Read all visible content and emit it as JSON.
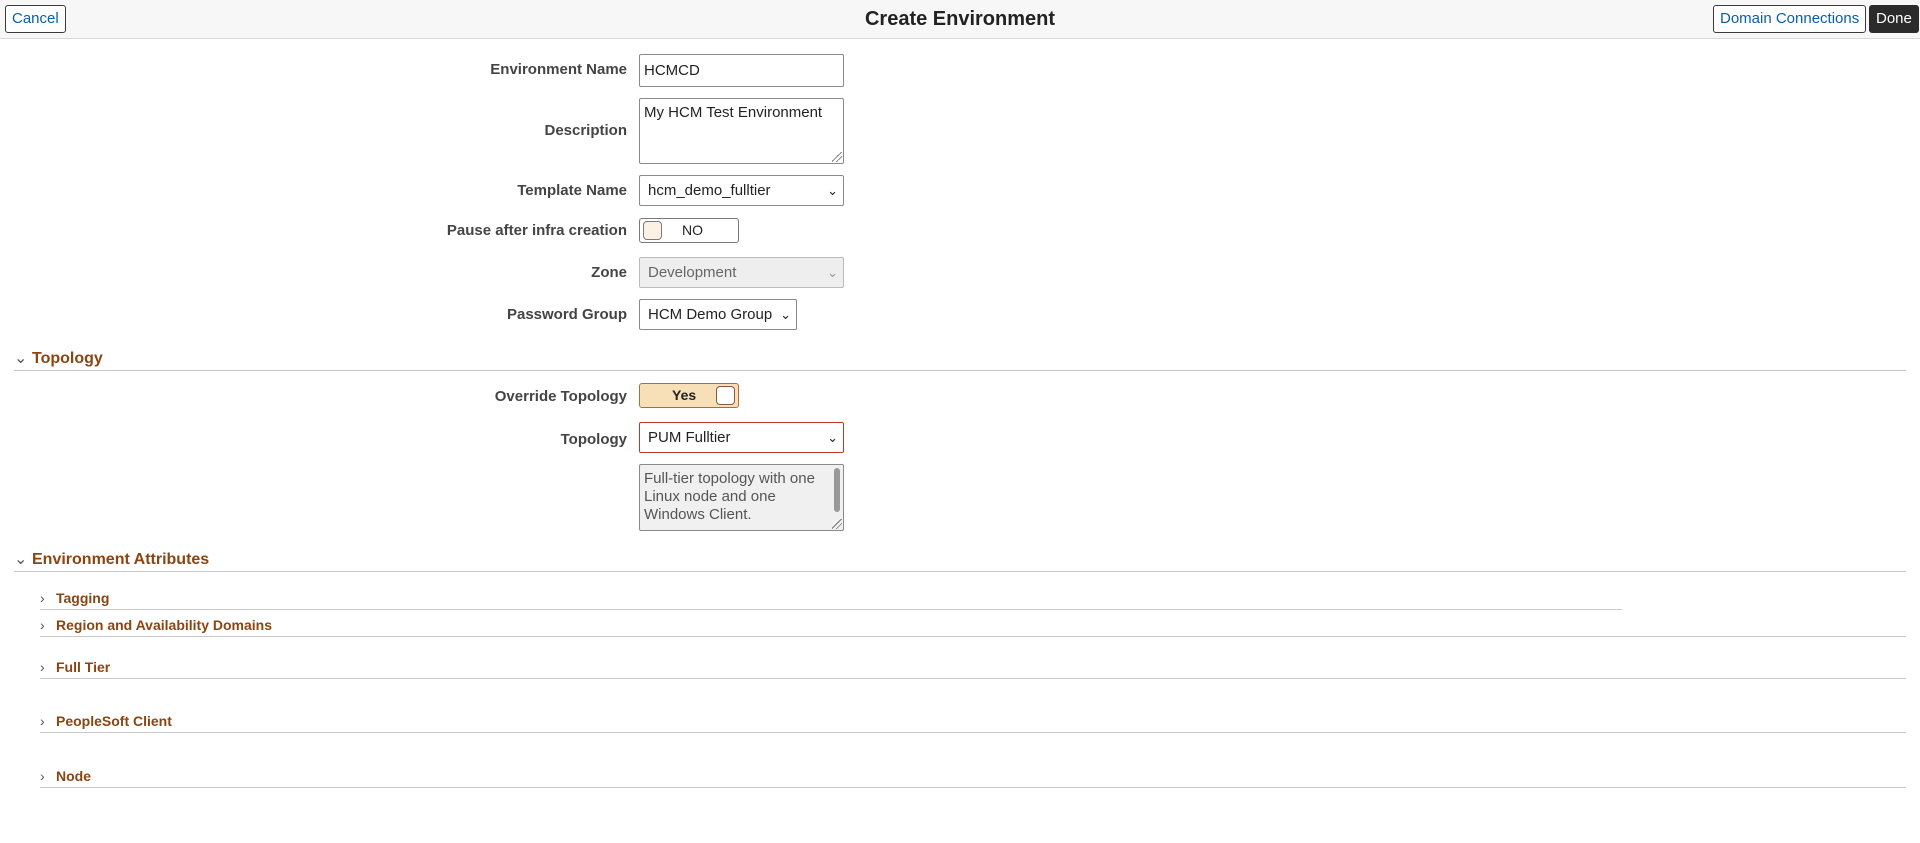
{
  "header": {
    "title": "Create Environment",
    "cancel_label": "Cancel",
    "domain_connections_label": "Domain Connections",
    "done_label": "Done"
  },
  "form": {
    "environment_name": {
      "label": "Environment Name",
      "value": "HCMCD"
    },
    "description": {
      "label": "Description",
      "value": "My HCM Test Environment"
    },
    "template_name": {
      "label": "Template Name",
      "value": "hcm_demo_fulltier"
    },
    "pause_after_infra": {
      "label": "Pause after infra creation",
      "value": "NO",
      "on": false
    },
    "zone": {
      "label": "Zone",
      "value": "Development",
      "disabled": true
    },
    "password_group": {
      "label": "Password Group",
      "value": "HCM Demo Group"
    }
  },
  "topology_section": {
    "title": "Topology",
    "expanded": true,
    "override_topology": {
      "label": "Override Topology",
      "value": "Yes",
      "on": true
    },
    "topology": {
      "label": "Topology",
      "value": "PUM Fulltier"
    },
    "topology_description": "Full-tier topology with one Linux node and one Windows Client."
  },
  "environment_attributes": {
    "title": "Environment Attributes",
    "expanded": true,
    "subsections": [
      {
        "title": "Tagging",
        "expanded": false
      },
      {
        "title": "Region and Availability Domains",
        "expanded": false
      },
      {
        "title": "Full Tier",
        "expanded": false
      },
      {
        "title": "PeopleSoft Client",
        "expanded": false
      },
      {
        "title": "Node",
        "expanded": false
      }
    ]
  },
  "icons": {
    "expanded": "chevron-down-icon",
    "collapsed": "chevron-right-icon",
    "dropdown": "chevron-down-icon"
  },
  "colors": {
    "section_title": "#8b4513",
    "link_blue": "#0b5ea8",
    "done_bg": "#2b2b2b",
    "toggle_on_bg": "#f7dfb8",
    "error_border": "#c0392b"
  }
}
